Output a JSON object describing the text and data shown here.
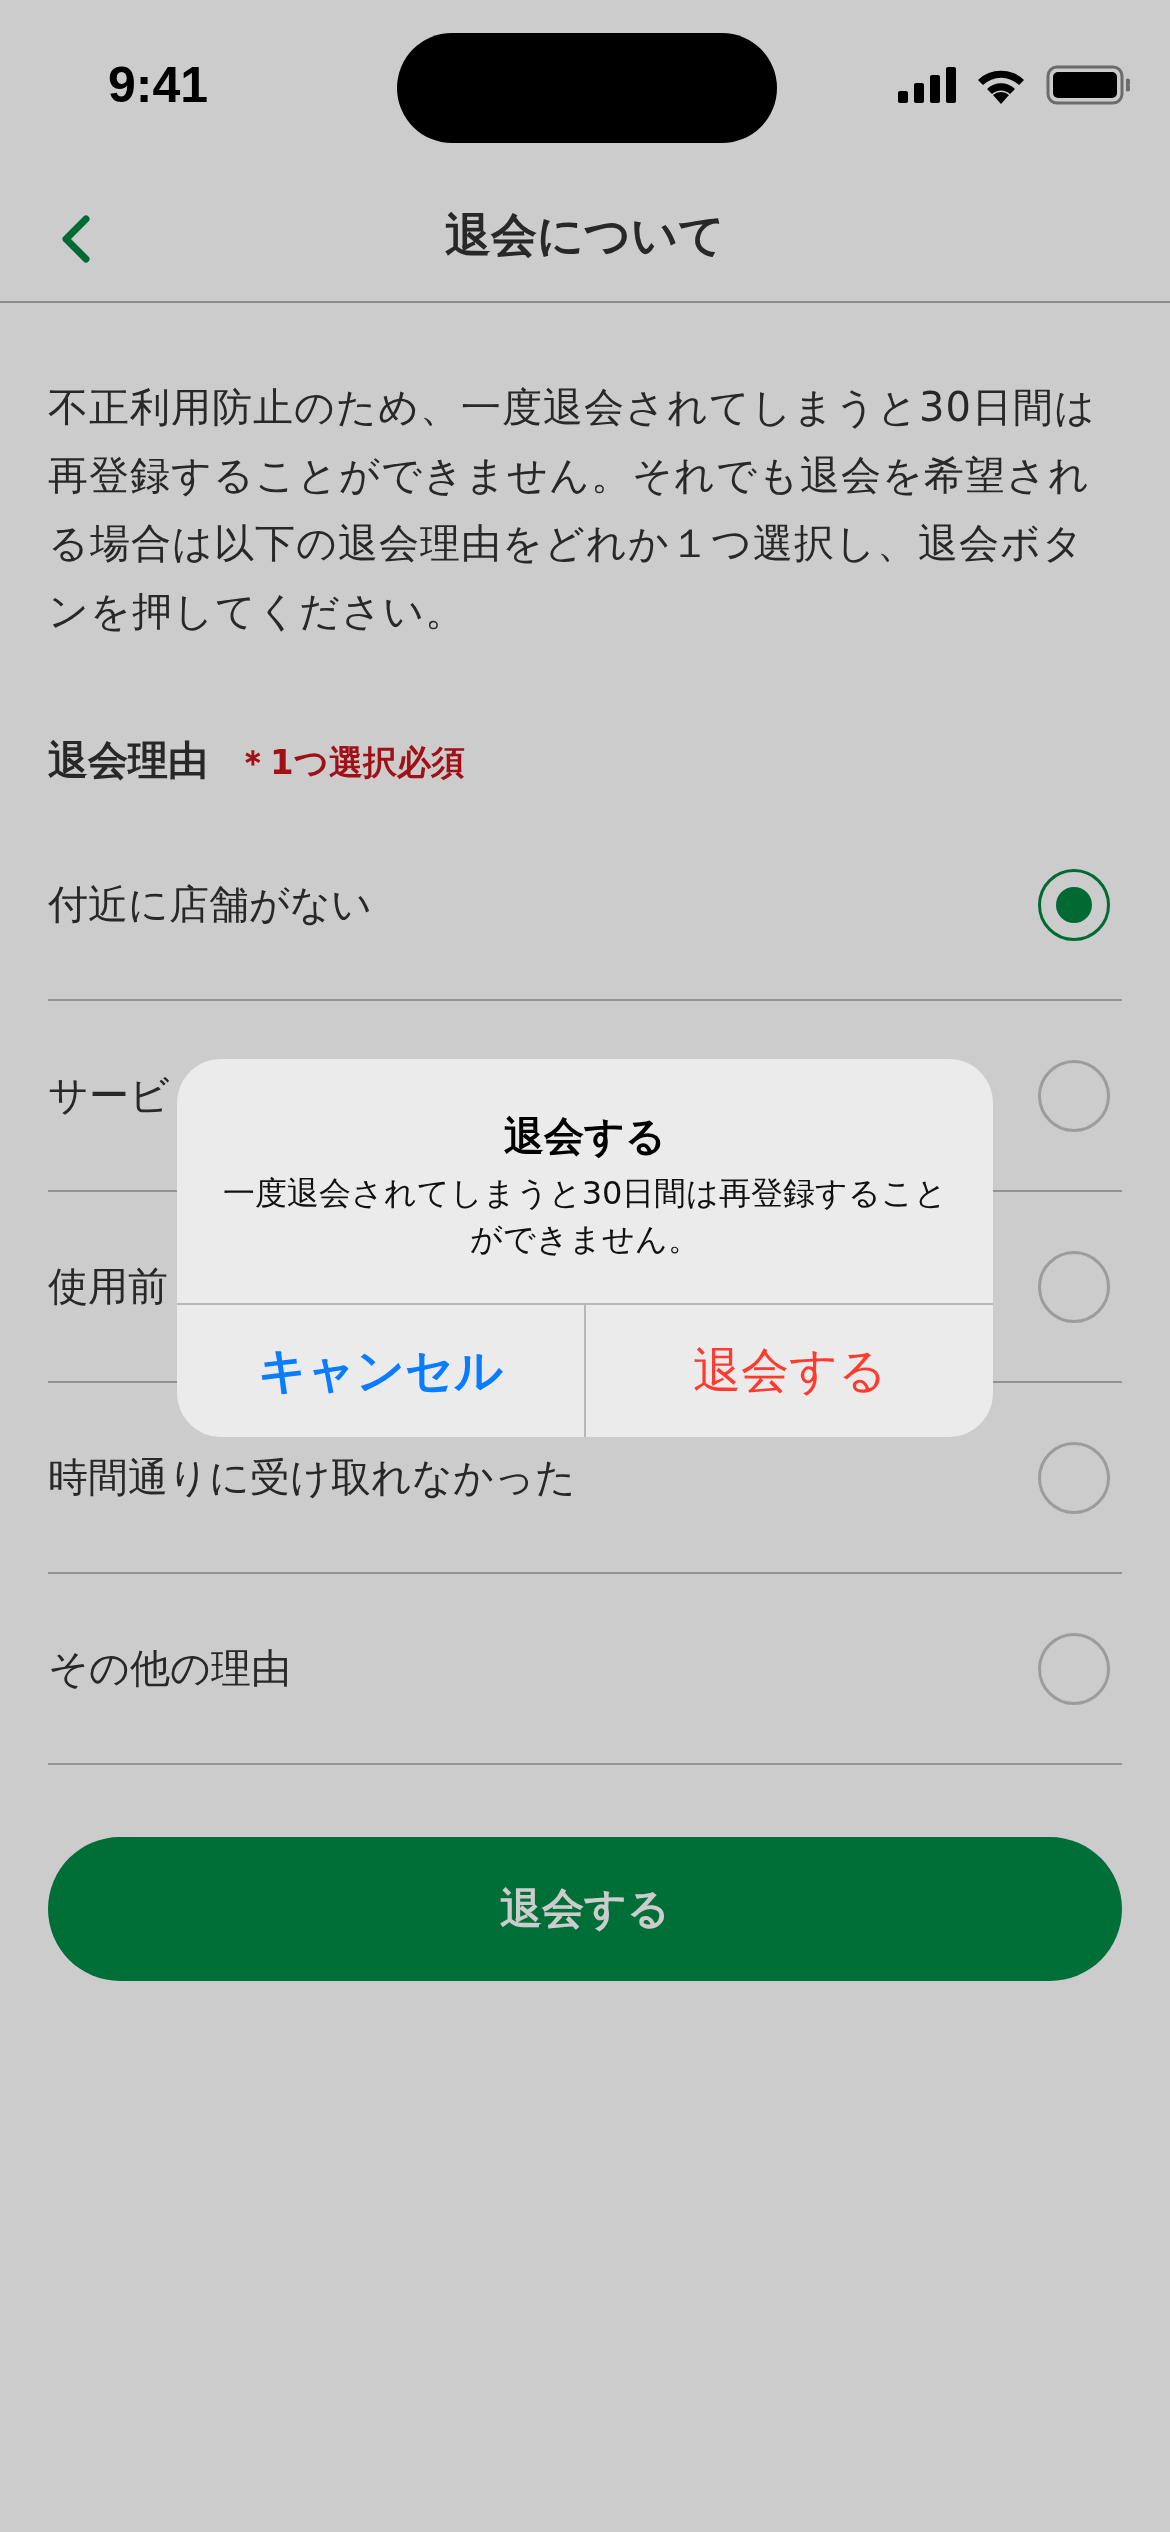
{
  "status_bar": {
    "time": "9:41"
  },
  "nav": {
    "title": "退会について"
  },
  "intro": "不正利用防止のため、一度退会されてしまうと30日間は再登録することができません。それでも退会を希望される場合は以下の退会理由をどれか１つ選択し、退会ボタンを押してください。",
  "reasons": {
    "heading": "退会理由",
    "required_note": "＊1つ選択必須",
    "options": [
      {
        "label": "付近に店舗がない",
        "selected": true
      },
      {
        "label": "サービ",
        "selected": false
      },
      {
        "label": "使用前",
        "selected": false
      },
      {
        "label": "時間通りに受け取れなかった",
        "selected": false
      },
      {
        "label": "その他の理由",
        "selected": false
      }
    ]
  },
  "submit_button": "退会する",
  "dialog": {
    "title": "退会する",
    "message": "一度退会されてしまうと30日間は再登録することができません。",
    "buttons": [
      {
        "label": "キャンセル",
        "kind": "cancel"
      },
      {
        "label": "退会する",
        "kind": "destructive"
      }
    ]
  }
}
